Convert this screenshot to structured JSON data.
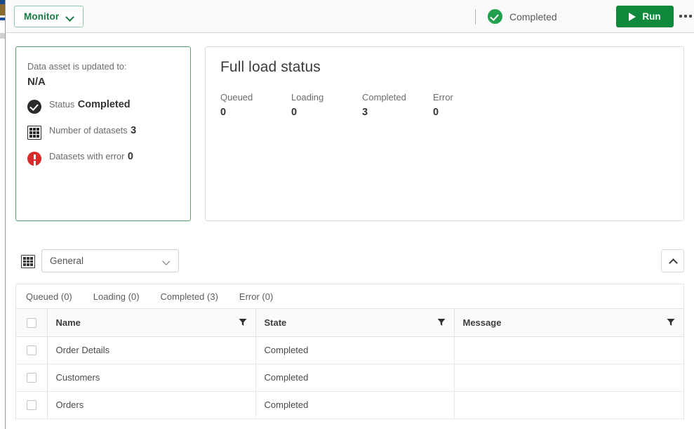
{
  "header": {
    "monitor_button": "Monitor",
    "status_text": "Completed",
    "run_button": "Run",
    "icons": {
      "monitor_chevron": "chevron-down-icon",
      "status": "check-circle-icon",
      "run": "play-icon",
      "more": "kebab-menu-icon"
    }
  },
  "summary_card": {
    "asset_label": "Data asset is updated to:",
    "asset_value": "N/A",
    "metrics": [
      {
        "icon": "check-circle-icon",
        "label": "Status",
        "value": "Completed"
      },
      {
        "icon": "table-grid-icon",
        "label": "Number of datasets",
        "value": "3"
      },
      {
        "icon": "error-circle-icon",
        "label": "Datasets with error",
        "value": "0"
      }
    ]
  },
  "load_status": {
    "title": "Full load status",
    "stats": [
      {
        "label": "Queued",
        "value": "0"
      },
      {
        "label": "Loading",
        "value": "0"
      },
      {
        "label": "Completed",
        "value": "3"
      },
      {
        "label": "Error",
        "value": "0"
      }
    ]
  },
  "toolbar": {
    "grid_icon": "table-grid-icon",
    "select_value": "General",
    "select_chevron": "chevron-down-icon",
    "collapse_icon": "chevron-up-icon"
  },
  "tabs": [
    {
      "label": "Queued (0)"
    },
    {
      "label": "Loading (0)"
    },
    {
      "label": "Completed (3)"
    },
    {
      "label": "Error (0)"
    }
  ],
  "table": {
    "columns": [
      "Name",
      "State",
      "Message"
    ],
    "filter_icon": "filter-funnel-icon",
    "rows": [
      {
        "name": "Order Details",
        "state": "Completed",
        "message": ""
      },
      {
        "name": "Customers",
        "state": "Completed",
        "message": ""
      },
      {
        "name": "Orders",
        "state": "Completed",
        "message": ""
      }
    ]
  },
  "colors": {
    "brand_green": "#1a7a44",
    "run_green": "#0f8a3c",
    "status_green": "#22a04d",
    "error_red": "#d92b2b",
    "card_border_green": "#5a9e6f"
  }
}
